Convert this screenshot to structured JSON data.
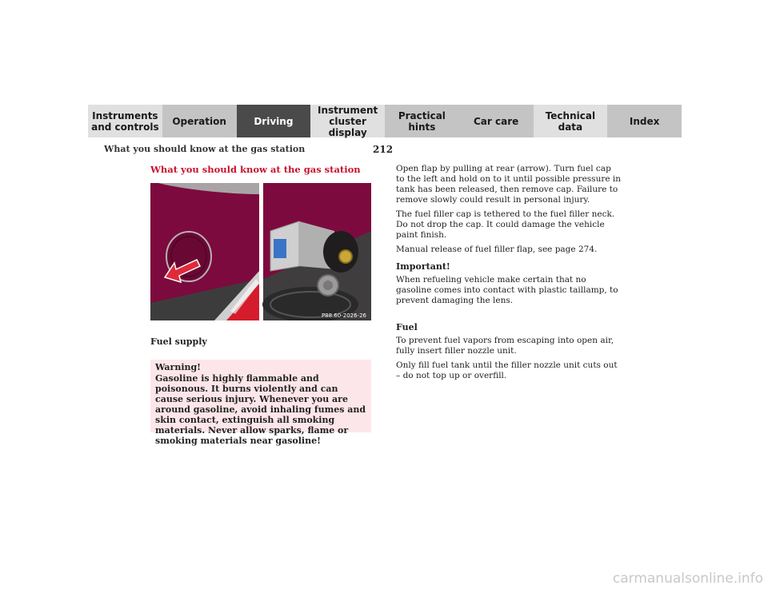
{
  "nav": {
    "tabs": [
      {
        "label": "Instruments\nand controls",
        "style": "light"
      },
      {
        "label": "Operation",
        "style": "normal"
      },
      {
        "label": "Driving",
        "style": "active"
      },
      {
        "label": "Instrument\ncluster display",
        "style": "light"
      },
      {
        "label": "Practical hints",
        "style": "normal"
      },
      {
        "label": "Car care",
        "style": "normal"
      },
      {
        "label": "Technical\ndata",
        "style": "light"
      },
      {
        "label": "Index",
        "style": "normal"
      }
    ]
  },
  "header": {
    "running_title": "What you should know at the gas station",
    "page_number": "212"
  },
  "section": {
    "title": "What you should know at the gas station",
    "figure_code": "P88.60-2026-26",
    "caption": "Fuel supply"
  },
  "warning": {
    "title": "Warning!",
    "text": "Gasoline is highly flammable and poisonous. It burns violently and can cause serious injury. Whenever you are around gasoline, avoid inhaling fumes and skin contact, extinguish all smoking materials. Never allow sparks, flame or smoking materials near gasoline!"
  },
  "right": {
    "p1": "Open flap by pulling at rear (arrow). Turn fuel cap to the left and hold on to it until possible pressure in tank has been released, then remove cap. Failure to remove slowly could result in personal injury.",
    "p2": "The fuel filler cap is tethered to the fuel filler neck. Do not drop the cap. It could damage the vehicle paint finish.",
    "p3": "Manual release of fuel filler flap, see page 274.",
    "important_heading": "Important!",
    "p4": "When refueling vehicle make certain that no gasoline comes into contact with plastic taillamp, to prevent damaging the lens.",
    "fuel_heading": "Fuel",
    "p5": "To prevent fuel vapors from escaping into open air, fully insert filler nozzle unit.",
    "p6": "Only fill fuel tank until the filler nozzle unit cuts out – do not top up or overfill."
  },
  "watermark": "carmanualsonline.info",
  "colors": {
    "accent_red": "#c8102e",
    "car_paint": "#7d0a3e",
    "tab_active": "#4a4a4a",
    "tab_normal": "#c4c4c4",
    "tab_light": "#e0e0e0",
    "warning_bg": "#fde6ea"
  }
}
